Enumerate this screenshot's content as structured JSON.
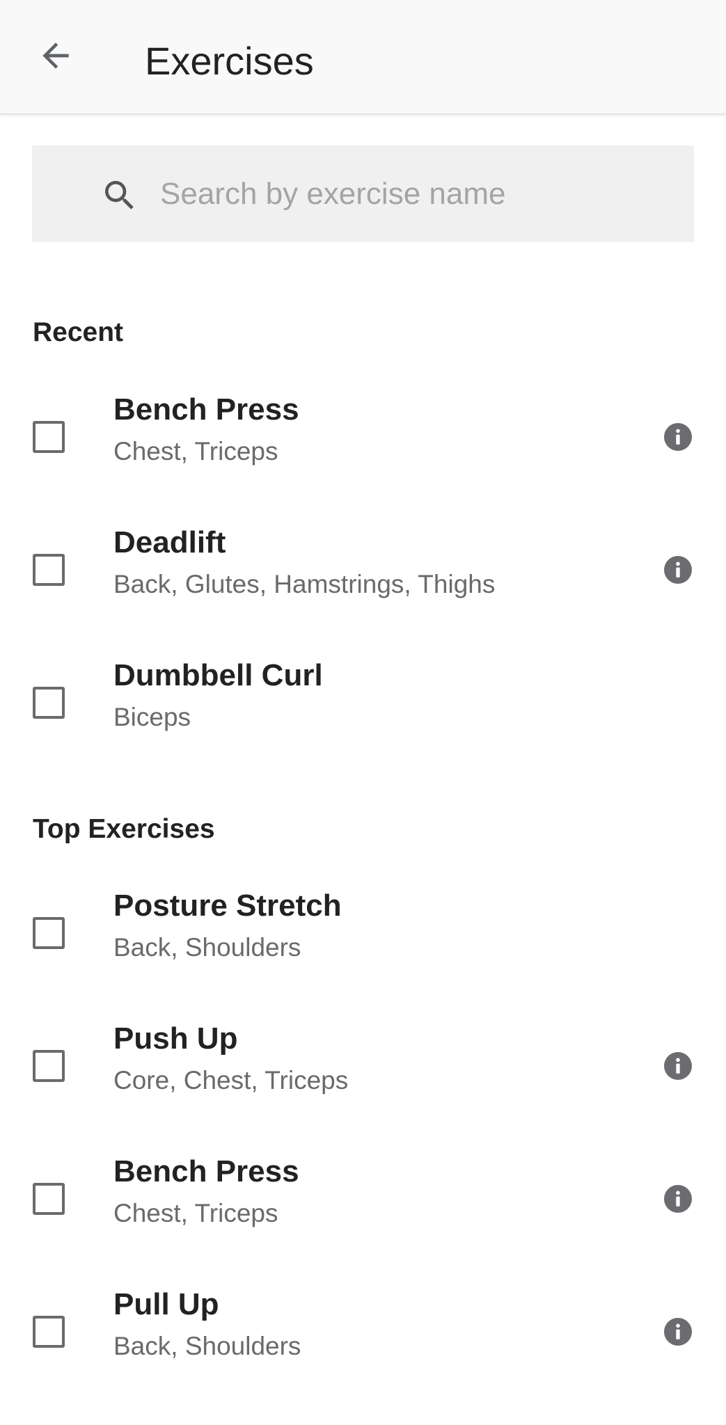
{
  "header": {
    "title": "Exercises",
    "back_icon": "arrow-left-icon"
  },
  "search": {
    "placeholder": "Search by exercise name",
    "value": "",
    "icon": "search-icon"
  },
  "sections": [
    {
      "title": "Recent",
      "items": [
        {
          "name": "Bench Press",
          "muscles": "Chest, Triceps",
          "checked": false,
          "has_info": true
        },
        {
          "name": "Deadlift",
          "muscles": "Back, Glutes, Hamstrings, Thighs",
          "checked": false,
          "has_info": true
        },
        {
          "name": "Dumbbell Curl",
          "muscles": "Biceps",
          "checked": false,
          "has_info": false
        }
      ]
    },
    {
      "title": "Top Exercises",
      "items": [
        {
          "name": "Posture Stretch",
          "muscles": "Back, Shoulders",
          "checked": false,
          "has_info": false
        },
        {
          "name": "Push Up",
          "muscles": "Core, Chest, Triceps",
          "checked": false,
          "has_info": true
        },
        {
          "name": "Bench Press",
          "muscles": "Chest, Triceps",
          "checked": false,
          "has_info": true
        },
        {
          "name": "Pull Up",
          "muscles": "Back, Shoulders",
          "checked": false,
          "has_info": true
        }
      ]
    }
  ],
  "colors": {
    "app_bar_bg": "#f9f9f9",
    "search_bg": "#f0f0f0",
    "text_primary": "#222222",
    "text_secondary": "#6a6a6a",
    "icon_gray": "#6b6b70"
  }
}
